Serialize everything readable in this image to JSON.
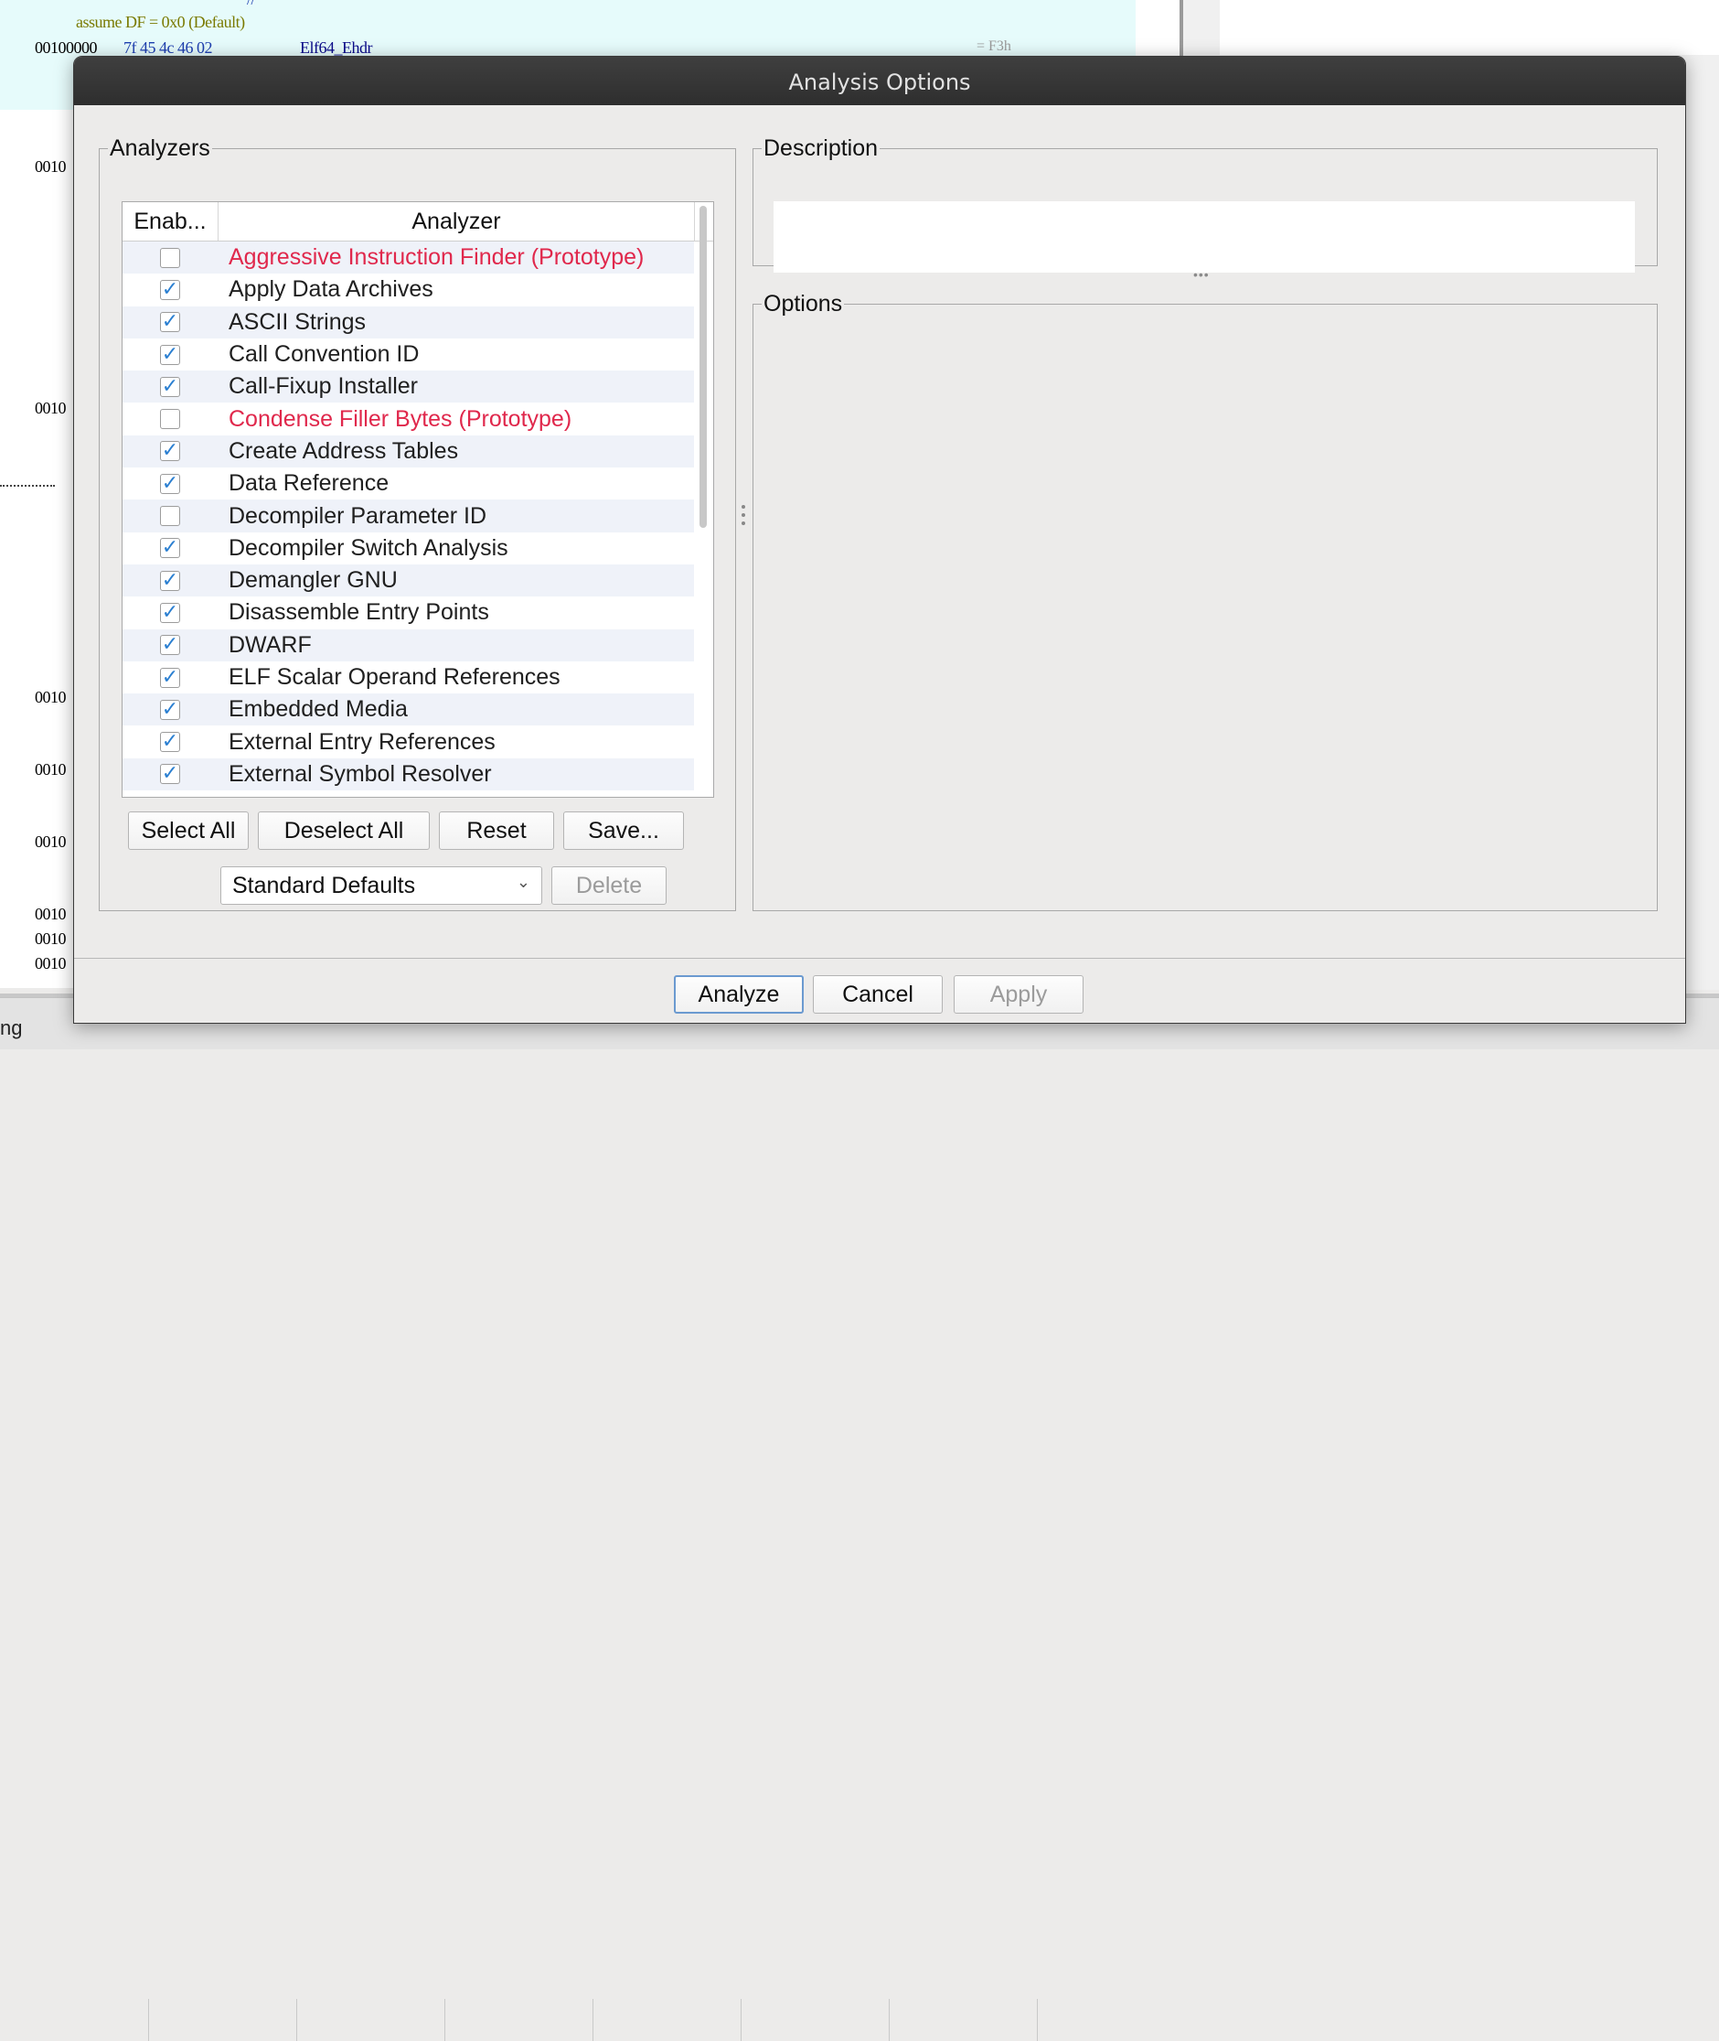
{
  "background": {
    "assume_line": "assume DF = 0x0  (Default)",
    "header_addr": "00100000",
    "header_bytes": "7f 45 4c 46 02",
    "header_type": "Elf64_Ehdr",
    "header_comment": "= F3h",
    "tick": "//",
    "left_addresses": [
      "0010",
      "0010",
      "0010",
      "0010",
      "0010",
      "0010",
      "0010",
      "0010"
    ],
    "status_text": "ng"
  },
  "dialog": {
    "title": "Analysis Options",
    "analyzers_legend": "Analyzers",
    "description_legend": "Description",
    "options_legend": "Options",
    "description_text": "",
    "table": {
      "col_enabled": "Enab...",
      "col_analyzer": "Analyzer",
      "rows": [
        {
          "enabled": false,
          "name": "Aggressive Instruction Finder (Prototype)",
          "prototype": true
        },
        {
          "enabled": true,
          "name": "Apply Data Archives",
          "prototype": false
        },
        {
          "enabled": true,
          "name": "ASCII Strings",
          "prototype": false
        },
        {
          "enabled": true,
          "name": "Call Convention ID",
          "prototype": false
        },
        {
          "enabled": true,
          "name": "Call-Fixup Installer",
          "prototype": false
        },
        {
          "enabled": false,
          "name": "Condense Filler Bytes (Prototype)",
          "prototype": true
        },
        {
          "enabled": true,
          "name": "Create Address Tables",
          "prototype": false
        },
        {
          "enabled": true,
          "name": "Data Reference",
          "prototype": false
        },
        {
          "enabled": false,
          "name": "Decompiler Parameter ID",
          "prototype": false
        },
        {
          "enabled": true,
          "name": "Decompiler Switch Analysis",
          "prototype": false
        },
        {
          "enabled": true,
          "name": "Demangler GNU",
          "prototype": false
        },
        {
          "enabled": true,
          "name": "Disassemble Entry Points",
          "prototype": false
        },
        {
          "enabled": true,
          "name": "DWARF",
          "prototype": false
        },
        {
          "enabled": true,
          "name": "ELF Scalar Operand References",
          "prototype": false
        },
        {
          "enabled": true,
          "name": "Embedded Media",
          "prototype": false
        },
        {
          "enabled": true,
          "name": "External Entry References",
          "prototype": false
        },
        {
          "enabled": true,
          "name": "External Symbol Resolver",
          "prototype": false
        }
      ]
    },
    "buttons": {
      "select_all": "Select All",
      "deselect_all": "Deselect All",
      "reset": "Reset",
      "save": "Save...",
      "delete": "Delete",
      "analyze": "Analyze",
      "cancel": "Cancel",
      "apply": "Apply"
    },
    "profile_select": {
      "value": "Standard Defaults"
    },
    "colors": {
      "prototype_text": "#e0284c",
      "checkmark": "#2b7fd1",
      "row_alt": "#eff2f9"
    }
  }
}
